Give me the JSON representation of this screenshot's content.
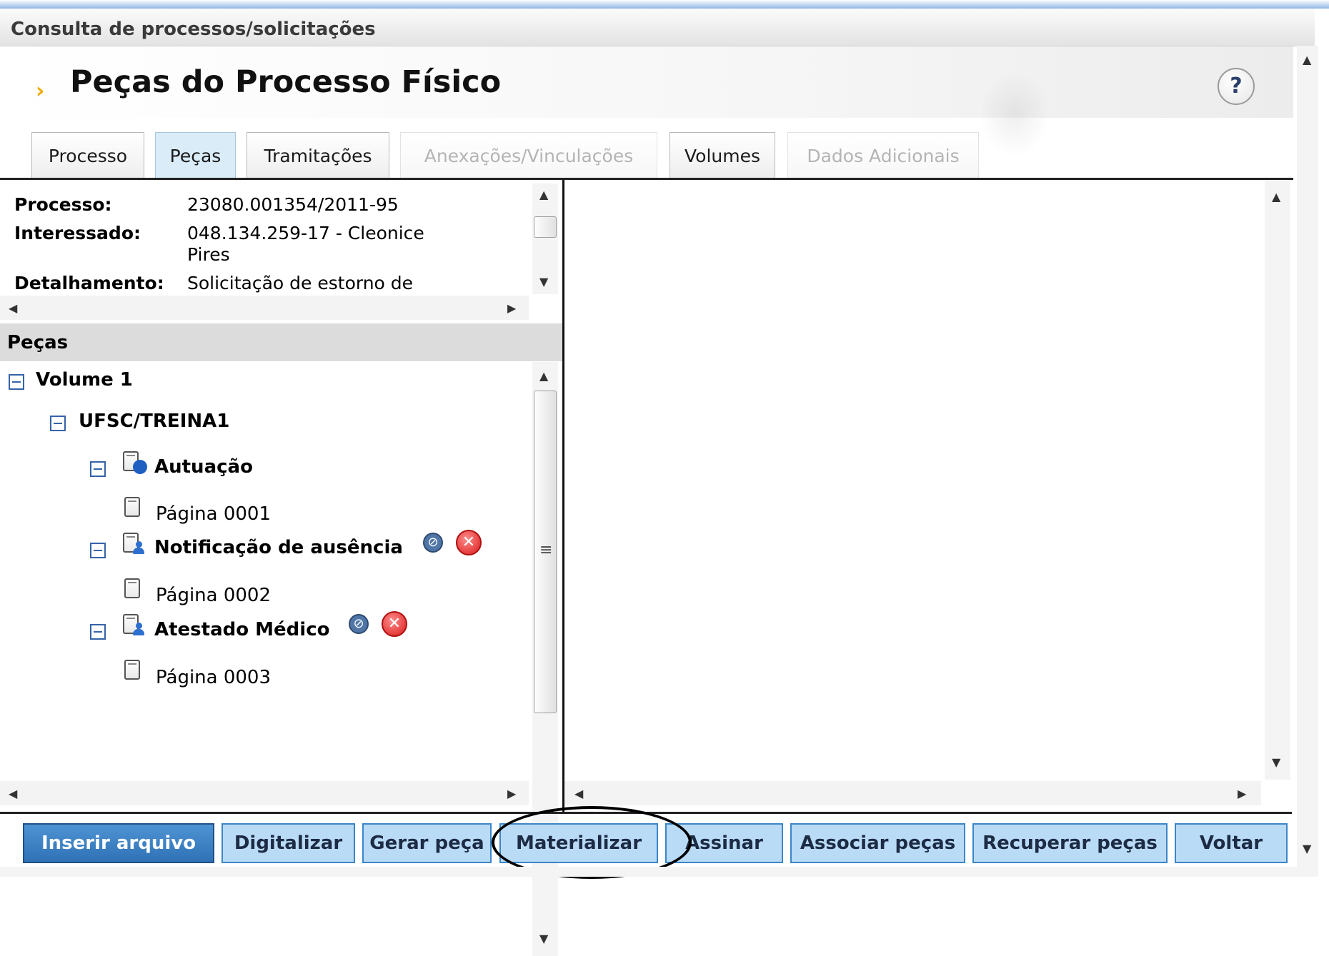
{
  "window": {
    "title": "Consulta de processos/solicitações"
  },
  "header": {
    "title": "Peças do Processo Físico",
    "help_label": "?"
  },
  "tabs": [
    {
      "label": "Processo",
      "state": "normal"
    },
    {
      "label": "Peças",
      "state": "active"
    },
    {
      "label": "Tramitações",
      "state": "normal"
    },
    {
      "label": "Anexações/Vinculações",
      "state": "disabled"
    },
    {
      "label": "Volumes",
      "state": "normal"
    },
    {
      "label": "Dados Adicionais",
      "state": "disabled"
    }
  ],
  "info": {
    "processo_key": "Processo:",
    "processo_value": "23080.001354/2011-95",
    "interessado_key": "Interessado:",
    "interessado_value_line1": "048.134.259-17 - Cleonice",
    "interessado_value_line2": "Pires",
    "detalhamento_key": "Detalhamento:",
    "detalhamento_value": "Solicitação de estorno de"
  },
  "pecas_section": {
    "title": "Peças"
  },
  "tree": {
    "volume": "Volume 1",
    "unit": "UFSC/TREINA1",
    "items": [
      {
        "label": "Autuação",
        "page": "Página 0001"
      },
      {
        "label": "Notificação de ausência",
        "page": "Página 0002"
      },
      {
        "label": "Atestado Médico",
        "page": "Página 0003"
      }
    ]
  },
  "icons": {
    "edit_glyph": "⊘",
    "delete_glyph": "✕",
    "scroll_up": "▲",
    "scroll_down": "▼",
    "scroll_left": "◀",
    "scroll_right": "▶",
    "grip": "≡"
  },
  "buttons": [
    {
      "label": "Inserir arquivo"
    },
    {
      "label": "Digitalizar"
    },
    {
      "label": "Gerar peça"
    },
    {
      "label": "Materializar"
    },
    {
      "label": "Assinar"
    },
    {
      "label": "Associar peças"
    },
    {
      "label": "Recuperar peças"
    },
    {
      "label": "Voltar"
    }
  ],
  "colors": {
    "active_tab": "#d9ecf8",
    "button_bg": "#b9dbf6",
    "primary_button": "#2f72b6",
    "bullet": "#f2a900",
    "delete": "#d91c1c"
  }
}
